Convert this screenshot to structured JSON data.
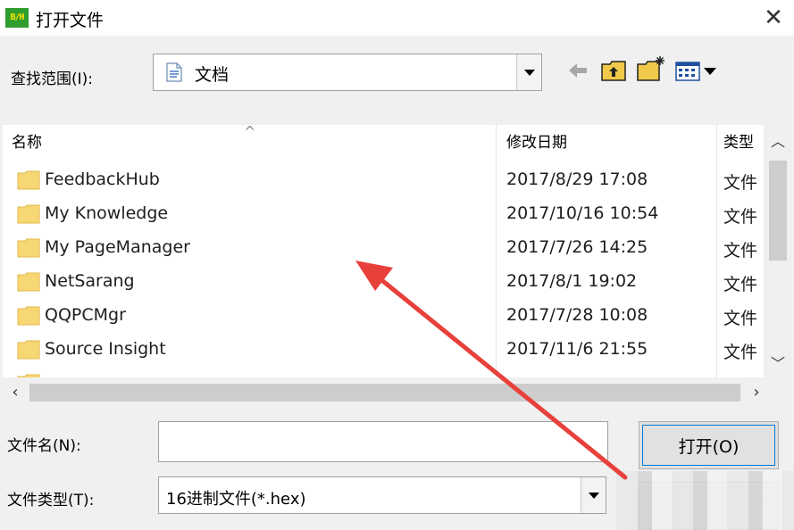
{
  "window": {
    "icon_text": "B/H",
    "title": "打开文件"
  },
  "lookin": {
    "label": "查找范围(I):",
    "value": "文档"
  },
  "columns": {
    "name": "名称",
    "date": "修改日期",
    "type": "类型"
  },
  "files": [
    {
      "name": "FeedbackHub",
      "date": "2017/8/29 17:08",
      "type": "文件"
    },
    {
      "name": "My Knowledge",
      "date": "2017/10/16 10:54",
      "type": "文件"
    },
    {
      "name": "My PageManager",
      "date": "2017/7/26 14:25",
      "type": "文件"
    },
    {
      "name": "NetSarang",
      "date": "2017/8/1 19:02",
      "type": "文件"
    },
    {
      "name": "QQPCMgr",
      "date": "2017/7/28 10:08",
      "type": "文件"
    },
    {
      "name": "Source Insight",
      "date": "2017/11/6 21:55",
      "type": "文件"
    }
  ],
  "filename": {
    "label": "文件名(N):",
    "value": ""
  },
  "filetype": {
    "label": "文件类型(T):",
    "value": "16进制文件(*.hex)"
  },
  "buttons": {
    "open": "打开(O)"
  },
  "colors": {
    "arrow": "#e8403a",
    "folder": "#f7d774",
    "focus": "#0078d7"
  }
}
